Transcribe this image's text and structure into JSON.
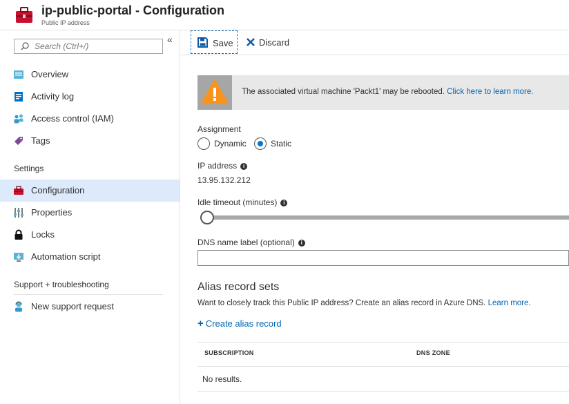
{
  "header": {
    "title": "ip-public-portal - Configuration",
    "subtitle": "Public IP address"
  },
  "sidebar": {
    "search_placeholder": "Search (Ctrl+/)",
    "collapse_glyph": "«",
    "items": [
      {
        "label": "Overview",
        "icon": "overview-icon"
      },
      {
        "label": "Activity log",
        "icon": "activity-log-icon"
      },
      {
        "label": "Access control (IAM)",
        "icon": "people-icon"
      },
      {
        "label": "Tags",
        "icon": "tag-icon"
      }
    ],
    "settings_header": "Settings",
    "settings_items": [
      {
        "label": "Configuration",
        "icon": "toolbox-icon",
        "active": true
      },
      {
        "label": "Properties",
        "icon": "sliders-icon"
      },
      {
        "label": "Locks",
        "icon": "lock-icon"
      },
      {
        "label": "Automation script",
        "icon": "script-icon"
      }
    ],
    "support_header": "Support + troubleshooting",
    "support_items": [
      {
        "label": "New support request",
        "icon": "support-person-icon"
      }
    ]
  },
  "toolbar": {
    "save_label": "Save",
    "discard_label": "Discard"
  },
  "warning": {
    "text": "The associated virtual machine 'Packt1' may be rebooted.",
    "link": "Click here to learn more."
  },
  "form": {
    "assignment_label": "Assignment",
    "dynamic_label": "Dynamic",
    "static_label": "Static",
    "selected_assignment": "Static",
    "ip_label": "IP address",
    "ip_value": "13.95.132.212",
    "idle_label": "Idle timeout (minutes)",
    "idle_slider_level": 0,
    "dns_label": "DNS name label (optional)",
    "dns_value": ""
  },
  "alias": {
    "title": "Alias record sets",
    "description": "Want to closely track this Public IP address? Create an alias record in Azure DNS.",
    "learn_more": "Learn more.",
    "create_label": "Create alias record",
    "columns": [
      "SUBSCRIPTION",
      "DNS ZONE"
    ],
    "empty_text": "No results."
  },
  "colors": {
    "accent": "#0078d4",
    "link": "#0066b4",
    "active_nav": "#ddeafb",
    "warning_orange": "#f7941d"
  }
}
